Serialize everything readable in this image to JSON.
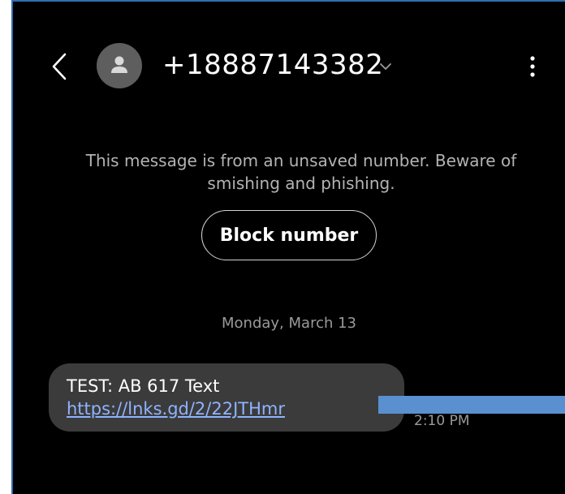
{
  "header": {
    "back_icon": "chevron-left-icon",
    "avatar_icon": "person-icon",
    "contact_number": "+18887143382",
    "expand_icon": "chevron-down-icon",
    "more_icon": "more-vertical-icon"
  },
  "notice": {
    "text": "This message is from an unsaved number. Beware of smishing and phishing.",
    "block_label": "Block number"
  },
  "conversation": {
    "date": "Monday, March 13",
    "messages": [
      {
        "prefix": "TEST: AB 617 Text ",
        "link_text": "https://lnks.gd/2/22JTHmr",
        "time": "2:10 PM"
      }
    ]
  },
  "colors": {
    "background": "#000000",
    "bubble": "#3b3b3b",
    "link": "#8fb3ff",
    "overlay": "#5a8fd0",
    "frame": "#2f6fb3"
  }
}
